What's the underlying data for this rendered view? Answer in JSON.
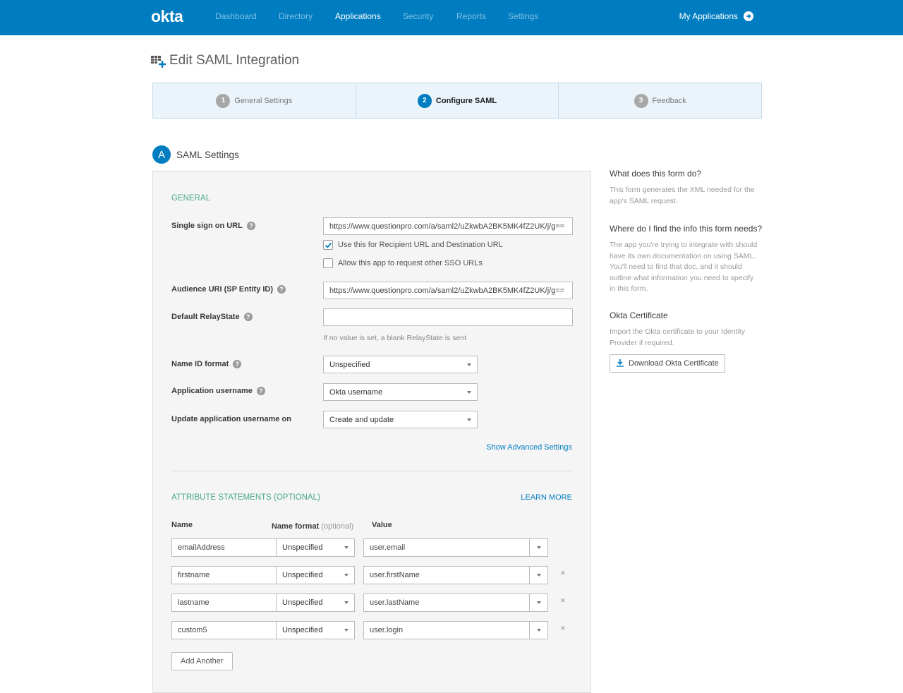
{
  "nav": {
    "logo": "okta",
    "links": [
      "Dashboard",
      "Directory",
      "Applications",
      "Security",
      "Reports",
      "Settings"
    ],
    "active": "Applications",
    "my_apps": "My Applications"
  },
  "page": {
    "title": "Edit SAML Integration"
  },
  "wizard": {
    "steps": [
      {
        "num": "1",
        "label": "General Settings"
      },
      {
        "num": "2",
        "label": "Configure SAML"
      },
      {
        "num": "3",
        "label": "Feedback"
      }
    ]
  },
  "section": {
    "badge": "A",
    "title": "SAML Settings"
  },
  "general": {
    "heading": "GENERAL",
    "sso_url_label": "Single sign on URL",
    "sso_url_value": "https://www.questionpro.com/a/saml2/uZkwbA2BK5MK4fZ2UK/j/g==",
    "recipient_checkbox": "Use this for Recipient URL and Destination URL",
    "other_sso_checkbox": "Allow this app to request other SSO URLs",
    "audience_label": "Audience URI (SP Entity ID)",
    "audience_value": "https://www.questionpro.com/a/saml2/uZkwbA2BK5MK4fZ2UK/j/g==",
    "relaystate_label": "Default RelayState",
    "relaystate_value": "",
    "relaystate_hint": "If no value is set, a blank RelayState is sent",
    "nameid_label": "Name ID format",
    "nameid_value": "Unspecified",
    "app_username_label": "Application username",
    "app_username_value": "Okta username",
    "update_label": "Update application username on",
    "update_value": "Create and update",
    "advanced_link": "Show Advanced Settings"
  },
  "attributes": {
    "heading": "ATTRIBUTE STATEMENTS (OPTIONAL)",
    "learn_more": "LEARN MORE",
    "col_name": "Name",
    "col_format": "Name format",
    "col_format_optional": "(optional)",
    "col_value": "Value",
    "rows": [
      {
        "name": "emailAddress",
        "format": "Unspecified",
        "value": "user.email"
      },
      {
        "name": "firstname",
        "format": "Unspecified",
        "value": "user.firstName"
      },
      {
        "name": "lastname",
        "format": "Unspecified",
        "value": "user.lastName"
      },
      {
        "name": "custom5",
        "format": "Unspecified",
        "value": "user.login"
      }
    ],
    "add_another": "Add Another"
  },
  "sidebar": {
    "q1": "What does this form do?",
    "a1": "This form generates the XML needed for the app's SAML request.",
    "q2": "Where do I find the info this form needs?",
    "a2": "The app you're trying to integrate with should have its own documentation on using SAML. You'll need to find that doc, and it should outline what information you need to specify in this form.",
    "q3": "Okta Certificate",
    "a3": "Import the Okta certificate to your Identity Provider if required.",
    "download_btn": "Download Okta Certificate"
  }
}
